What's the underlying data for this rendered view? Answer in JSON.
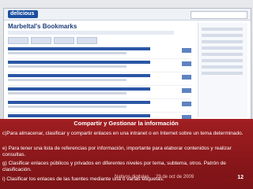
{
  "slide": {
    "app_logo_text": "delicious",
    "page_title": "Marbeltal's Bookmarks",
    "caption": {
      "heading": "Compartir y Gestionar la información",
      "points": [
        "c)Para almacenar, clasificar y compartir enlaces en una intranet o en Internet sobre un tema determinado.",
        "e) Para tener una lista de referencias por información, importante para elaborar contenidos y realizar consultas.",
        "g) Clasificar enlaces públicos y privados en diferentes  niveles por tema, subtema, otros. Patrón de clasificación.",
        "i) Clasificar los enlaces de las fuentes mediante una o varias etiquetas."
      ]
    },
    "footer": {
      "left": "Nativos digitales",
      "date": "29 de oct de 2009",
      "page_number": "12"
    },
    "colors": {
      "band_top": "#a31f22",
      "band_bottom": "#7c1316",
      "link_blue": "#2b56a6"
    }
  }
}
